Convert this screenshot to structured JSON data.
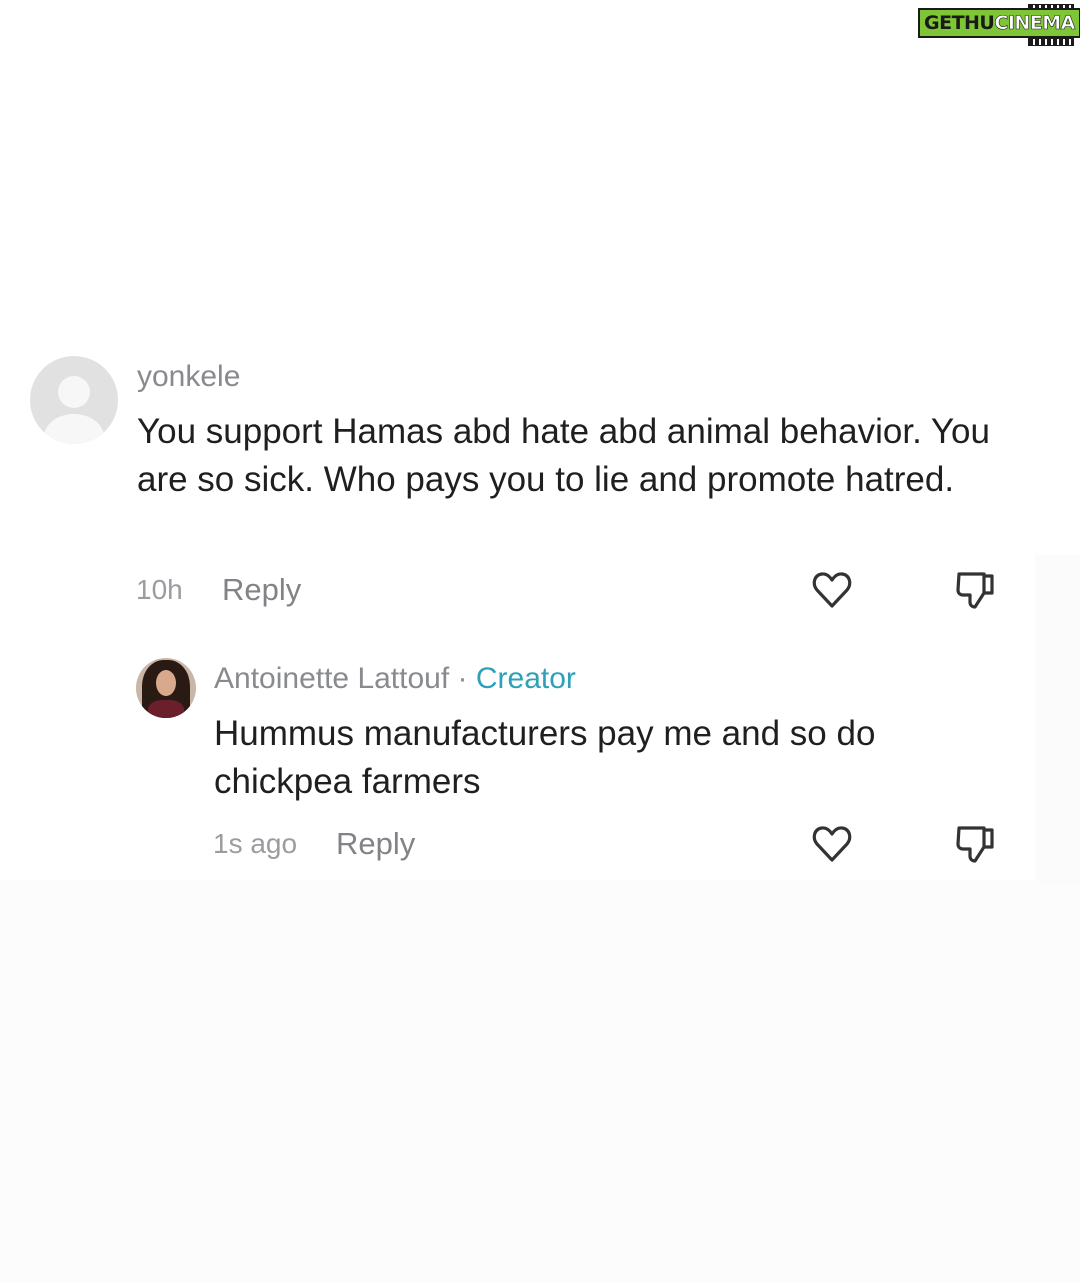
{
  "watermark": {
    "part1": "GETHU",
    "part2": "CINEMA"
  },
  "comments": [
    {
      "username": "yonkele",
      "text": "You support Hamas abd hate abd animal behavior. You are so sick. Who pays you to lie and promote hatred.",
      "time": "10h",
      "reply_label": "Reply",
      "avatar_icon": "default-avatar-icon",
      "like_icon": "heart-icon",
      "dislike_icon": "thumbs-down-icon"
    },
    {
      "username": "Antoinette Lattouf",
      "separator": "·",
      "badge": "Creator",
      "text": "Hummus manufacturers pay me and so do chickpea farmers",
      "time": "1s ago",
      "reply_label": "Reply",
      "avatar_icon": "profile-photo",
      "like_icon": "heart-icon",
      "dislike_icon": "thumbs-down-icon"
    }
  ],
  "colors": {
    "username": "#888a8e",
    "creator_badge": "#2ea0b8",
    "body_text": "#1f1f1f",
    "watermark_green": "#7ec636"
  }
}
